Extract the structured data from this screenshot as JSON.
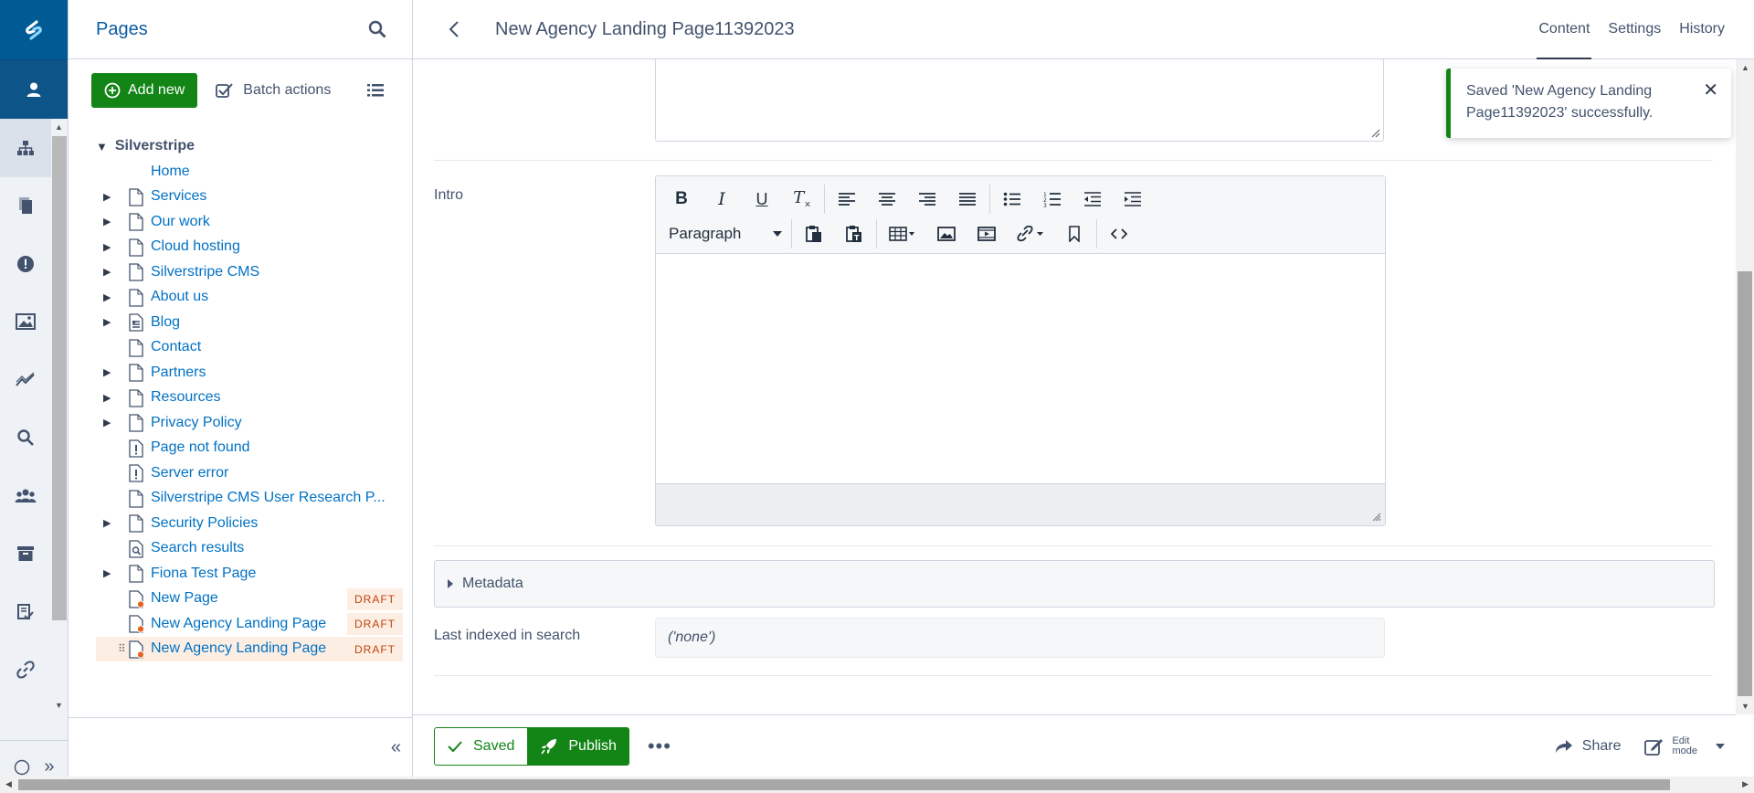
{
  "tree_panel": {
    "title": "Pages",
    "add_new_label": "Add new",
    "batch_actions_label": "Batch actions",
    "root_label": "Silverstripe",
    "nodes": [
      {
        "label": "Home",
        "toggle": false,
        "icon": "none"
      },
      {
        "label": "Services",
        "toggle": true,
        "icon": "page-icon"
      },
      {
        "label": "Our work",
        "toggle": true,
        "icon": "page-icon"
      },
      {
        "label": "Cloud hosting",
        "toggle": true,
        "icon": "page-icon"
      },
      {
        "label": "Silverstripe CMS",
        "toggle": true,
        "icon": "page-icon"
      },
      {
        "label": "About us",
        "toggle": true,
        "icon": "page-icon"
      },
      {
        "label": "Blog",
        "toggle": true,
        "icon": "blog-icon"
      },
      {
        "label": "Contact",
        "toggle": false,
        "icon": "page-icon"
      },
      {
        "label": "Partners",
        "toggle": true,
        "icon": "page-icon"
      },
      {
        "label": "Resources",
        "toggle": true,
        "icon": "page-icon"
      },
      {
        "label": "Privacy Policy",
        "toggle": true,
        "icon": "page-icon"
      },
      {
        "label": "Page not found",
        "toggle": false,
        "icon": "error-page-icon"
      },
      {
        "label": "Server error",
        "toggle": false,
        "icon": "error-page-icon"
      },
      {
        "label": "Silverstripe CMS User Research P...",
        "toggle": false,
        "icon": "page-icon"
      },
      {
        "label": "Security Policies",
        "toggle": true,
        "icon": "page-icon"
      },
      {
        "label": "Search results",
        "toggle": false,
        "icon": "search-page-icon"
      },
      {
        "label": "Fiona Test Page",
        "toggle": true,
        "icon": "page-icon"
      },
      {
        "label": "New Page",
        "toggle": false,
        "icon": "draft-page-icon",
        "badge": "DRAFT"
      },
      {
        "label": "New Agency Landing Page",
        "toggle": false,
        "icon": "draft-page-icon",
        "badge": "DRAFT"
      },
      {
        "label": "New Agency Landing Page",
        "toggle": false,
        "icon": "draft-page-icon",
        "badge": "DRAFT",
        "selected": true
      }
    ],
    "collapse_label": "«"
  },
  "header": {
    "page_title": "New Agency Landing Page11392023",
    "tabs": [
      "Content",
      "Settings",
      "History"
    ],
    "active_tab": "Content"
  },
  "form": {
    "intro_label": "Intro",
    "format_select": "Paragraph",
    "metadata_label": "Metadata",
    "last_indexed_label": "Last indexed in search",
    "last_indexed_value": "('none')"
  },
  "actions": {
    "saved_label": "Saved",
    "publish_label": "Publish",
    "more_label": "•••",
    "share_label": "Share",
    "edit_mode_line1": "Edit",
    "edit_mode_line2": "mode"
  },
  "toast": {
    "message": "Saved 'New Agency Landing Page11392023' successfully."
  },
  "colors": {
    "brand_blue": "#005a93",
    "primary_green": "#128516",
    "link_blue": "#0071c4",
    "draft_badge_bg": "#fdeee3",
    "draft_badge_text": "#c2410c"
  }
}
